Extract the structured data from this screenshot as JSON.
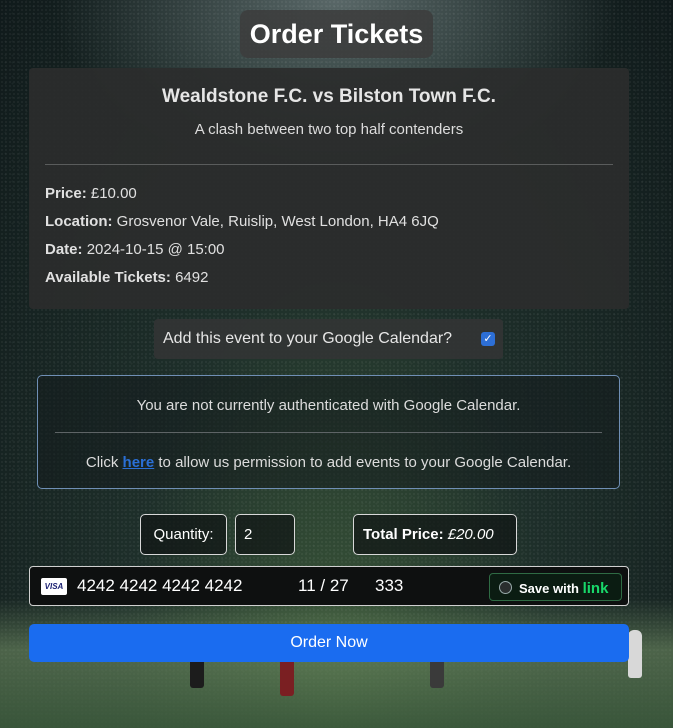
{
  "page": {
    "title": "Order Tickets"
  },
  "event": {
    "name": "Wealdstone F.C. vs Bilston Town F.C.",
    "description": "A clash between two top half contenders",
    "price_label": "Price:",
    "price": "£10.00",
    "location_label": "Location:",
    "location": "Grosvenor Vale, Ruislip, West London, HA4 6JQ",
    "date_label": "Date:",
    "date": "2024-10-15 @ 15:00",
    "tickets_label": "Available Tickets:",
    "tickets": "6492"
  },
  "google_calendar": {
    "prompt": "Add this event to your Google Calendar?",
    "checked": true,
    "auth_message": "You are not currently authenticated with Google Calendar.",
    "permission_prefix": "Click",
    "permission_link": "here",
    "permission_suffix": "to allow us permission to add events to your Google Calendar."
  },
  "order": {
    "quantity_label": "Quantity:",
    "quantity": "2",
    "total_label": "Total Price:",
    "total": "£20.00"
  },
  "payment": {
    "card_brand_icon": "visa-icon",
    "card_brand": "VISA",
    "card_number": "4242 4242 4242 4242",
    "expiry": "11 / 27",
    "cvc": "333",
    "save_label": "Save with",
    "save_brand": "link"
  },
  "actions": {
    "order_button": "Order Now"
  },
  "colors": {
    "primary": "#1a6cf0",
    "link_brand": "#18d86a",
    "checkbox": "#2d6fd6"
  }
}
